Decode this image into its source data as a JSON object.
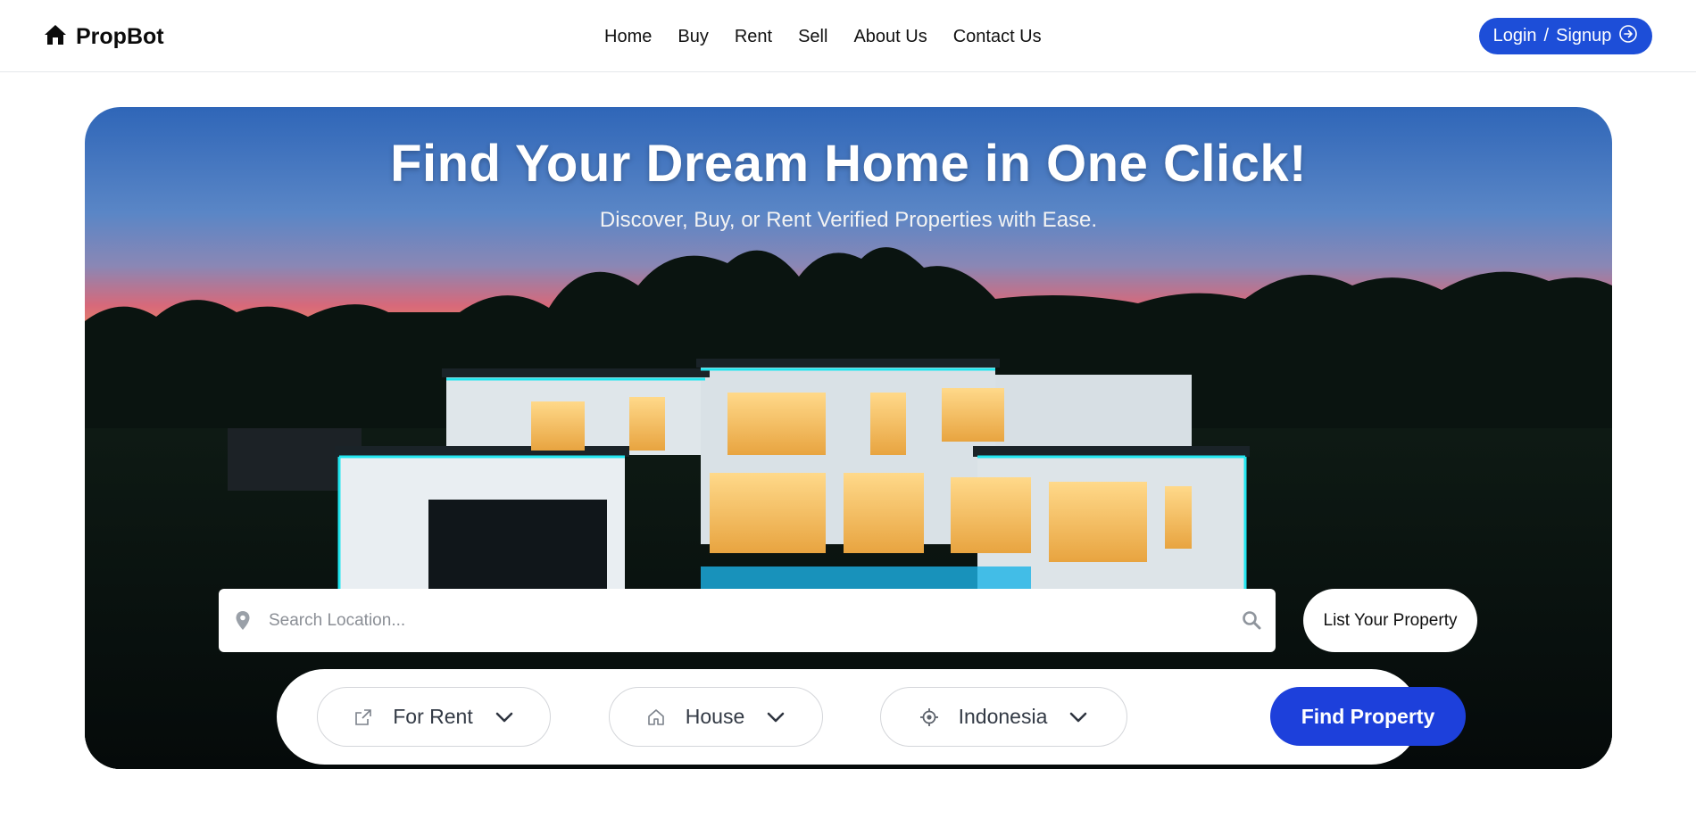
{
  "brand": {
    "name": "PropBot",
    "icon": "home-icon"
  },
  "nav": {
    "items": [
      {
        "label": "Home"
      },
      {
        "label": "Buy"
      },
      {
        "label": "Rent"
      },
      {
        "label": "Sell"
      },
      {
        "label": "About Us"
      },
      {
        "label": "Contact Us"
      }
    ]
  },
  "auth": {
    "login_label": "Login",
    "separator": "/",
    "signup_label": "Signup",
    "icon": "arrow-circle-right-icon"
  },
  "hero": {
    "title": "Find Your Dream Home in One Click!",
    "subtitle": "Discover, Buy, or Rent Verified Properties with Ease."
  },
  "search": {
    "placeholder": "Search Location...",
    "value": "",
    "pin_icon": "map-pin-icon",
    "search_icon": "search-icon"
  },
  "list_property": {
    "label": "List Your Property"
  },
  "filters": {
    "listing_type": {
      "value": "For Rent",
      "icon": "external-link-icon"
    },
    "property_type": {
      "value": "House",
      "icon": "home-outline-icon"
    },
    "country": {
      "value": "Indonesia",
      "icon": "crosshair-icon"
    }
  },
  "find_button": {
    "label": "Find Property"
  },
  "colors": {
    "primary": "#1d4ed8",
    "find_button": "#1d40db",
    "text_dark": "#111111"
  }
}
